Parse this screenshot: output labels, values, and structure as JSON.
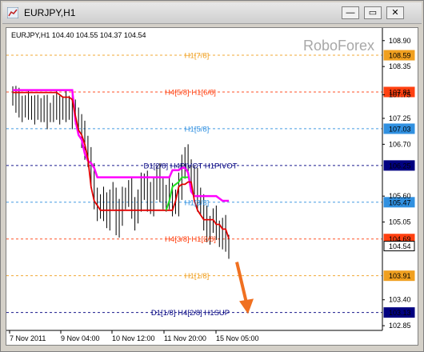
{
  "window": {
    "title": "EURJPY,H1",
    "buttons": {
      "minimize": "—",
      "restore": "▭",
      "close": "✕"
    }
  },
  "chart_data": {
    "type": "candlestick",
    "symbol_info": "EURJPY,H1  104.40 104.55 104.37 104.54",
    "watermark": "RoboForex",
    "ylim": [
      102.75,
      109.1
    ],
    "y_ticks": [
      108.9,
      108.59,
      108.35,
      107.81,
      107.75,
      107.25,
      107.03,
      106.7,
      106.25,
      105.6,
      105.47,
      105.05,
      104.69,
      104.54,
      103.91,
      103.4,
      103.13,
      102.85
    ],
    "x_labels": [
      "7 Nov 2011",
      "9 Nov 04:00",
      "10 Nov 12:00",
      "11 Nov 20:00",
      "15 Nov 05:00"
    ],
    "levels": [
      {
        "price": 108.59,
        "label": "H1[7/8]",
        "color": "#f0a020"
      },
      {
        "price": 107.81,
        "label": "H4[5/8] H1[6/8]",
        "color": "#ff4010"
      },
      {
        "price": 107.03,
        "label": "H1[5/8]",
        "color": "#3090e0"
      },
      {
        "price": 106.25,
        "label": "D1[2/8] H4PIVOT H1PIVOT",
        "color": "#000080"
      },
      {
        "price": 105.47,
        "label": "H1[3/8]",
        "color": "#3090e0"
      },
      {
        "price": 104.69,
        "label": "H4[3/8] H1[2/8]",
        "color": "#ff4010"
      },
      {
        "price": 103.91,
        "label": "H1[1/8]",
        "color": "#f0a020"
      },
      {
        "price": 103.13,
        "label": "D1[1/8] H4[2/8] H1SUP",
        "color": "#000080"
      }
    ],
    "price_badges": [
      {
        "value": "108.59",
        "color": "#f0a020"
      },
      {
        "value": "107.81",
        "color": "#ff4010"
      },
      {
        "value": "107.03",
        "color": "#3090e0"
      },
      {
        "value": "106.25",
        "color": "#000080"
      },
      {
        "value": "105.47",
        "color": "#3090e0"
      },
      {
        "value": "104.69",
        "color": "#ff4010"
      },
      {
        "value": "104.54",
        "color": "#ffffff"
      },
      {
        "value": "103.91",
        "color": "#f0a020"
      },
      {
        "value": "103.13",
        "color": "#000080"
      }
    ],
    "closes": [
      107.7,
      107.6,
      107.55,
      107.5,
      107.45,
      107.55,
      107.5,
      107.45,
      107.4,
      107.5,
      107.45,
      107.35,
      107.4,
      107.5,
      107.55,
      107.45,
      107.4,
      107.55,
      107.5,
      107.35,
      107.3,
      107.1,
      106.9,
      106.7,
      106.4,
      106.0,
      105.6,
      105.4,
      105.3,
      105.5,
      105.2,
      105.5,
      105.6,
      105.0,
      105.3,
      105.5,
      105.6,
      105.7,
      105.4,
      105.2,
      105.5,
      105.8,
      105.9,
      105.6,
      105.4,
      105.8,
      106.0,
      105.8,
      105.5,
      105.6,
      105.7,
      105.5,
      105.4,
      105.8,
      106.3,
      106.4,
      106.2,
      106.0,
      105.9,
      105.6,
      105.4,
      105.1,
      104.9,
      105.0,
      105.1,
      104.9,
      104.8,
      104.9,
      104.6,
      104.5
    ],
    "red_line": [
      107.8,
      107.8,
      107.8,
      107.8,
      107.8,
      107.8,
      107.8,
      107.8,
      107.8,
      107.8,
      107.8,
      107.8,
      107.8,
      107.8,
      107.8,
      107.75,
      107.7,
      107.7,
      107.7,
      107.65,
      107.3,
      107.0,
      106.9,
      106.7,
      106.4,
      105.8,
      105.5,
      105.4,
      105.3,
      105.3,
      105.3,
      105.3,
      105.3,
      105.3,
      105.3,
      105.3,
      105.3,
      105.3,
      105.3,
      105.3,
      105.3,
      105.3,
      105.3,
      105.3,
      105.3,
      105.3,
      105.3,
      105.3,
      105.3,
      105.3,
      105.3,
      105.3,
      105.5,
      105.8,
      105.85,
      105.85,
      105.9,
      105.9,
      105.5,
      105.3,
      105.2,
      105.1,
      105.1,
      105.1,
      105.1,
      105.0,
      105.0,
      104.9,
      104.9,
      104.7
    ],
    "magenta_line": [
      107.85,
      107.85,
      107.85,
      107.85,
      107.85,
      107.85,
      107.85,
      107.85,
      107.85,
      107.85,
      107.85,
      107.85,
      107.85,
      107.85,
      107.85,
      107.85,
      107.85,
      107.85,
      107.85,
      107.85,
      107.2,
      106.9,
      106.8,
      106.5,
      106.35,
      106.3,
      106.2,
      106.0,
      106.0,
      106.0,
      106.0,
      106.0,
      106.0,
      106.0,
      106.0,
      106.0,
      106.0,
      106.0,
      106.0,
      106.0,
      106.0,
      106.0,
      106.0,
      106.0,
      106.0,
      106.0,
      106.0,
      106.0,
      106.0,
      106.0,
      106.0,
      106.15,
      106.15,
      106.15,
      106.2,
      106.2,
      106.1,
      105.7,
      105.6,
      105.6,
      105.6,
      105.6,
      105.6,
      105.6,
      105.6,
      105.6,
      105.55,
      105.5,
      105.5,
      105.5
    ],
    "green_line": [
      105.3,
      105.5,
      105.8,
      105.85,
      105.9,
      106.0,
      106.0,
      106.0
    ],
    "green_start_index": 49,
    "arrow": {
      "from_price": 104.2,
      "to_price": 103.1,
      "color": "#f07020"
    }
  }
}
